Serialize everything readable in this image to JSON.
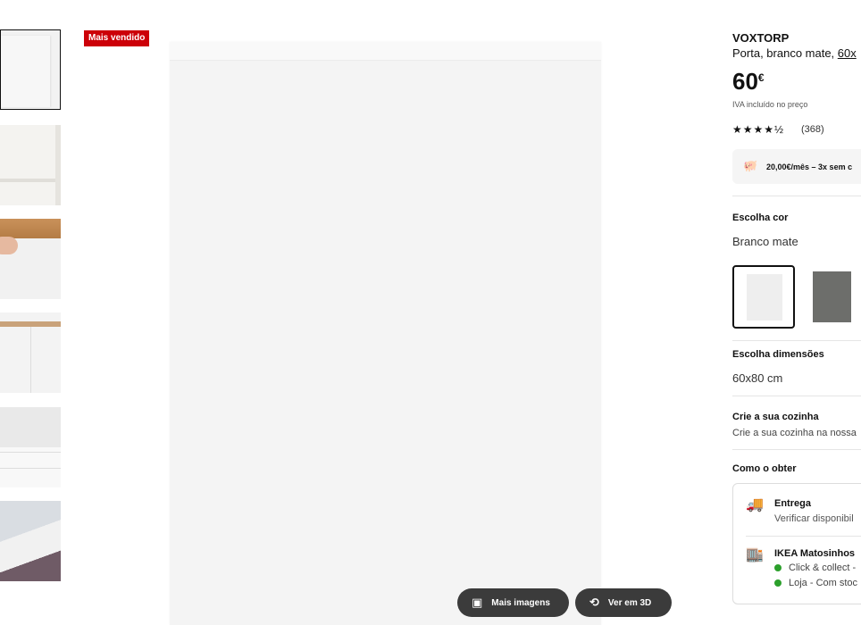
{
  "badge": "Mais vendido",
  "product": {
    "name": "VOXTORP",
    "desc_text": "Porta, branco mate, ",
    "desc_link": "60x",
    "price_whole": "60",
    "price_currency": "€",
    "vat_note": "IVA incluído no preço",
    "stars": "★★★★½",
    "review_count": "(368)",
    "finance_text": "20,00€/mês – 3x sem c"
  },
  "color": {
    "label": "Escolha cor",
    "value": "Branco mate",
    "swatch_colors": [
      "#eeeeee",
      "#6d6e6b"
    ]
  },
  "size": {
    "label": "Escolha dimensões",
    "value": "60x80 cm"
  },
  "kitchen": {
    "title": "Crie a sua cozinha",
    "subtitle": "Crie a sua cozinha na nossa"
  },
  "obtain": {
    "label": "Como o obter",
    "delivery_title": "Entrega",
    "delivery_sub": "Verificar disponibil",
    "store_title": "IKEA Matosinhos",
    "store_line1": "Click & collect -",
    "store_line2": "Loja - Com stoc"
  },
  "gallery": {
    "more_images": "Mais imagens",
    "view_3d": "Ver em 3D"
  }
}
